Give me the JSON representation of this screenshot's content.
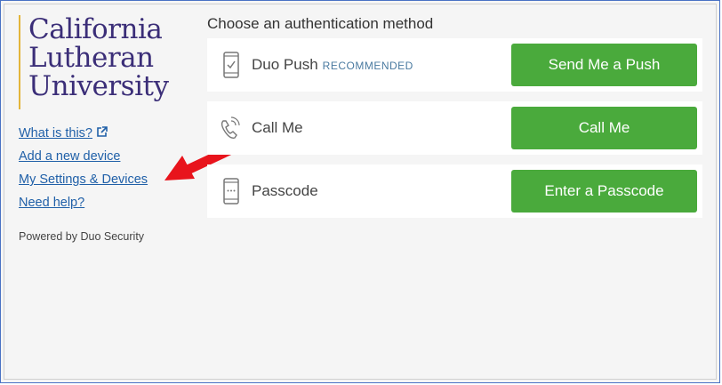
{
  "sidebar": {
    "logo_lines": [
      "California",
      "Lutheran",
      "University"
    ],
    "links": [
      {
        "label": "What is this?"
      },
      {
        "label": "Add a new device"
      },
      {
        "label": "My Settings & Devices"
      },
      {
        "label": "Need help?"
      }
    ],
    "powered_by": "Powered by Duo Security"
  },
  "main": {
    "heading": "Choose an authentication method",
    "methods": [
      {
        "label": "Duo Push",
        "badge": "RECOMMENDED",
        "button": "Send Me a Push",
        "icon": "phone-check-icon"
      },
      {
        "label": "Call Me",
        "button": "Call Me",
        "icon": "phone-call-icon"
      },
      {
        "label": "Passcode",
        "button": "Enter a Passcode",
        "icon": "phone-passcode-icon"
      }
    ]
  },
  "colors": {
    "accent_green": "#4aaa3c",
    "link_blue": "#2060a8",
    "logo_purple": "#3b2e78",
    "logo_gold": "#e3b53a",
    "arrow_red": "#e8141c"
  }
}
